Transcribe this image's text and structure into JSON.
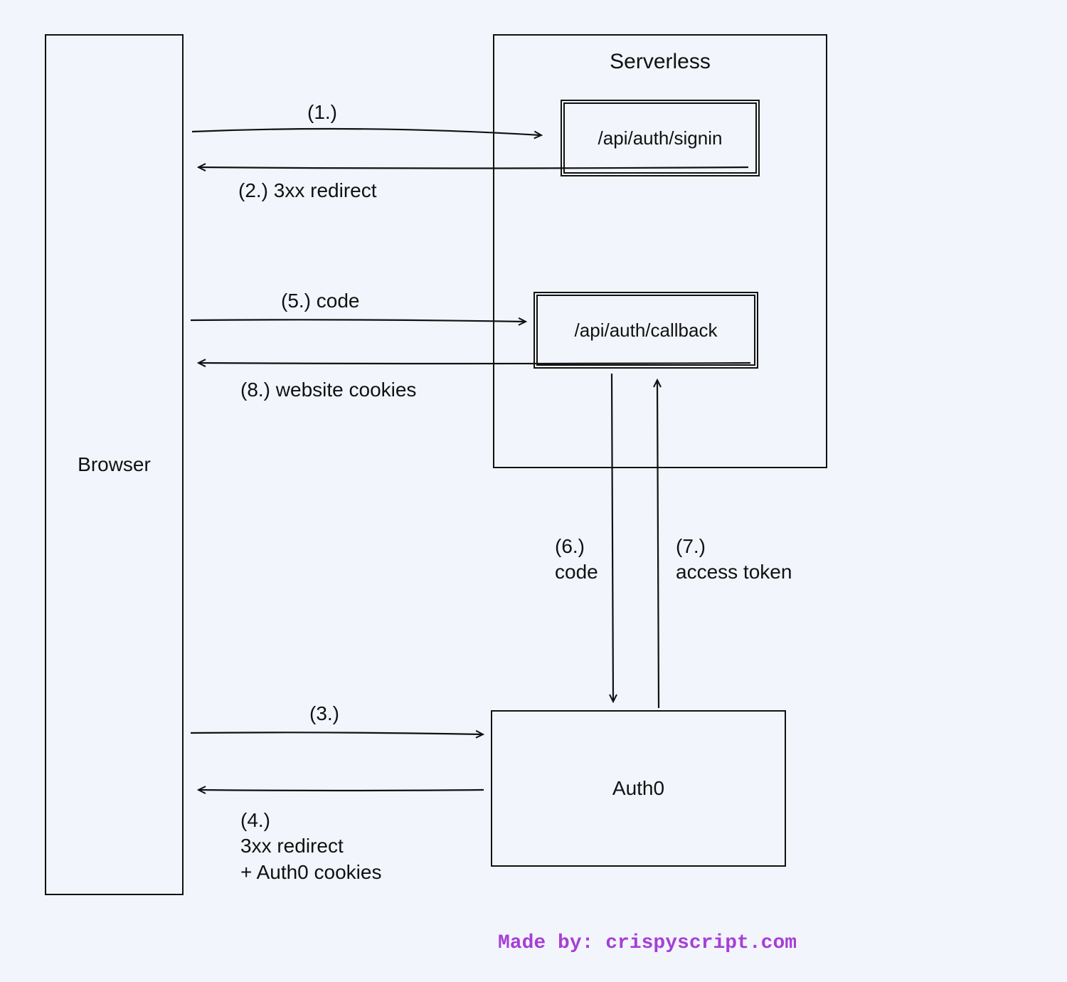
{
  "boxes": {
    "browser": "Browser",
    "serverless_title": "Serverless",
    "signin": "/api/auth/signin",
    "callback": "/api/auth/callback",
    "auth0": "Auth0"
  },
  "labels": {
    "step1": "(1.)",
    "step2": "(2.) 3xx redirect",
    "step3": "(3.)",
    "step4": "(4.)\n3xx redirect\n+ Auth0 cookies",
    "step5": "(5.) code",
    "step6": "(6.)\ncode",
    "step7": "(7.)\naccess token",
    "step8": "(8.) website cookies"
  },
  "attribution": "Made by: crispyscript.com"
}
